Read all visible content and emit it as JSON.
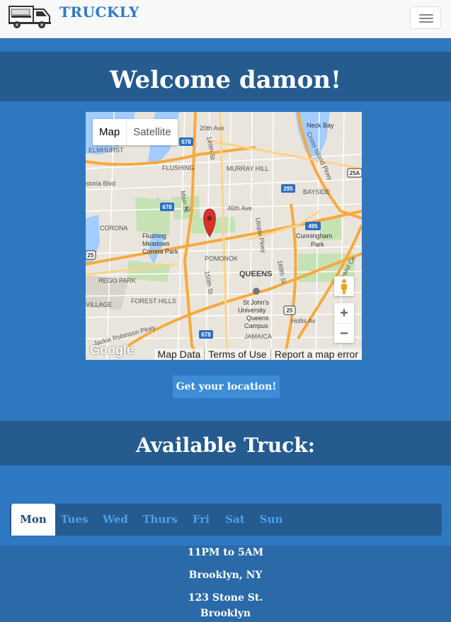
{
  "brand": {
    "name": "TRUCKLY"
  },
  "header": {
    "welcome": "Welcome damon!"
  },
  "map": {
    "type_buttons": {
      "map": "Map",
      "satellite": "Satellite"
    },
    "zoom_in": "+",
    "zoom_out": "−",
    "logo_text": "Google",
    "attribution": {
      "data": "Map Data",
      "terms": "Terms of Use",
      "report": "Report a map error"
    },
    "labels": {
      "20th Ave": "20th Ave",
      "Flushing": "FLUSHING",
      "Murray Hill": "MURRAY HILL",
      "Bayside": "BAYSIDE",
      "Elmhurst": "ELMHURST",
      "Corona": "CORONA",
      "Flushing Meadows": "Flushing",
      "Flushing Meadows 2": "Meadows",
      "Flushing Meadows 3": "Corona Park",
      "Pomonok": "POMONOK",
      "Queens": "QUEENS",
      "Rego Park": "REGO PARK",
      "Forest Hills": "FOREST HILLS",
      "St Johns": "St John's",
      "University": "University",
      "Queens Campus": "Queens",
      "Campus": "Campus",
      "Jamaica": "JAMAICA",
      "Cunningham": "Cunningham",
      "Park": "Park",
      "46th Ave": "46th Ave",
      "Utopia Pkwy": "Utopia Pkwy",
      "Main St": "Main St",
      "149th St": "149th St",
      "150th St": "150th St",
      "188th St": "188th St",
      "Hollis": "Hollis Av",
      "Jackie Robinson": "Jackie Robinson Pkwy",
      "Grand Central": "Grand Ce",
      "Village": "VILLAGE",
      "Storia": "storia Blvd",
      "Cross Island": "Cross Island Pkwy",
      "Little Neck Bay": "Neck Bay",
      "Kissena": "Ki",
      "shield_678": "678",
      "shield_295": "295",
      "shield_495": "495",
      "shield_25": "25",
      "shield_25A": "25A"
    }
  },
  "actions": {
    "get_location": "Get your location!"
  },
  "section": {
    "title": "Available Truck:"
  },
  "tabs": [
    {
      "label": "Mon",
      "active": true
    },
    {
      "label": "Tues",
      "active": false
    },
    {
      "label": "Wed",
      "active": false
    },
    {
      "label": "Thurs",
      "active": false
    },
    {
      "label": "Fri",
      "active": false
    },
    {
      "label": "Sat",
      "active": false
    },
    {
      "label": "Sun",
      "active": false
    }
  ],
  "schedule": {
    "hours": "11PM to 5AM",
    "city": "Brooklyn, NY",
    "address": "123 Stone St.",
    "area": "Brooklyn"
  },
  "colors": {
    "brand_blue": "#2e78c1",
    "band_blue": "#255b8f",
    "tab_text": "#4d9fe8",
    "marker_red": "#d9312c"
  },
  "icons": {
    "logo": "food-truck-icon",
    "menu": "hamburger-menu-icon",
    "marker": "map-pin-icon",
    "pegman": "street-view-pegman-icon"
  }
}
